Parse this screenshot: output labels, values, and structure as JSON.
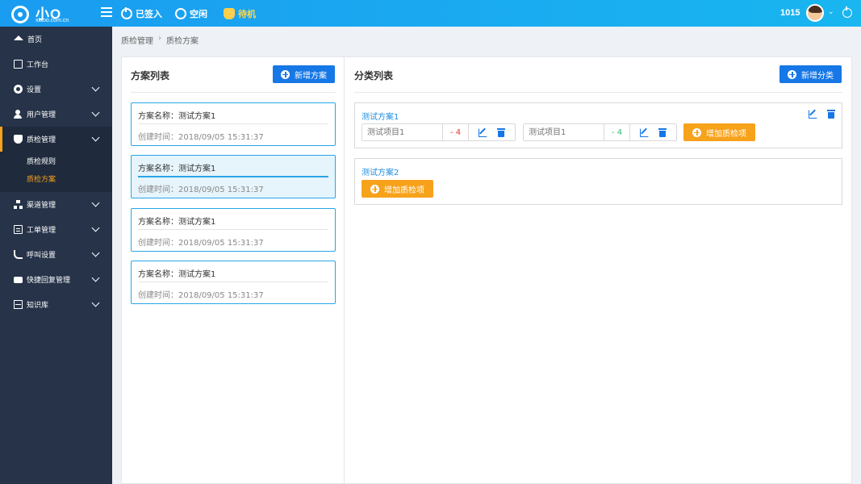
{
  "header": {
    "logo_text": "小O",
    "logo_sub": "xiaoo.com.cn",
    "status_signed_in": "已签入",
    "status_idle": "空闲",
    "status_waiting": "待机",
    "user_number": "1015"
  },
  "sidebar": {
    "items": [
      {
        "label": "首页",
        "icon": "home-icon"
      },
      {
        "label": "工作台",
        "icon": "monitor-icon"
      },
      {
        "label": "设置",
        "icon": "gear-icon"
      },
      {
        "label": "用户管理",
        "icon": "user-icon"
      },
      {
        "label": "质检管理",
        "icon": "shield-icon"
      },
      {
        "label": "渠道管理",
        "icon": "sitemap-icon"
      },
      {
        "label": "工单管理",
        "icon": "document-icon"
      },
      {
        "label": "呼叫设置",
        "icon": "phone-icon"
      },
      {
        "label": "快捷回复管理",
        "icon": "chat-icon"
      },
      {
        "label": "知识库",
        "icon": "book-icon"
      }
    ],
    "sub_items": [
      {
        "label": "质检规则"
      },
      {
        "label": "质检方案"
      }
    ],
    "accent_color": "#f7a21b"
  },
  "breadcrumb": {
    "parent": "质检管理",
    "separator": "›",
    "current": "质检方案"
  },
  "scheme_panel": {
    "title": "方案列表",
    "add_button": "新增方案",
    "schemes": [
      {
        "name": "方案名称：测试方案1",
        "created": "创建时间：2018/09/05   15:31:37"
      },
      {
        "name": "方案名称：测试方案1",
        "created": "创建时间：2018/09/05   15:31:37"
      },
      {
        "name": "方案名称：测试方案1",
        "created": "创建时间：2018/09/05   15:31:37"
      },
      {
        "name": "方案名称：测试方案1",
        "created": "创建时间：2018/09/05   15:31:37"
      }
    ],
    "selected_index": 1
  },
  "category_panel": {
    "title": "分类列表",
    "add_button": "新增分类",
    "categories": [
      {
        "name": "测试方案1",
        "items": [
          {
            "placeholder": "测试项目1",
            "score": "- 4",
            "score_color": "#e53935"
          },
          {
            "placeholder": "测试项目1",
            "score": "- 4",
            "score_color": "#2fbf71"
          }
        ],
        "add_item_button": "增加质检项"
      },
      {
        "name": "测试方案2",
        "items": [],
        "add_item_button": "增加质检项"
      }
    ]
  },
  "colors": {
    "primary": "#1677e6",
    "topbar": "#1aa6f0",
    "sidebar_bg": "#263349",
    "orange": "#f7a21b",
    "card_border": "#29a6e6"
  }
}
